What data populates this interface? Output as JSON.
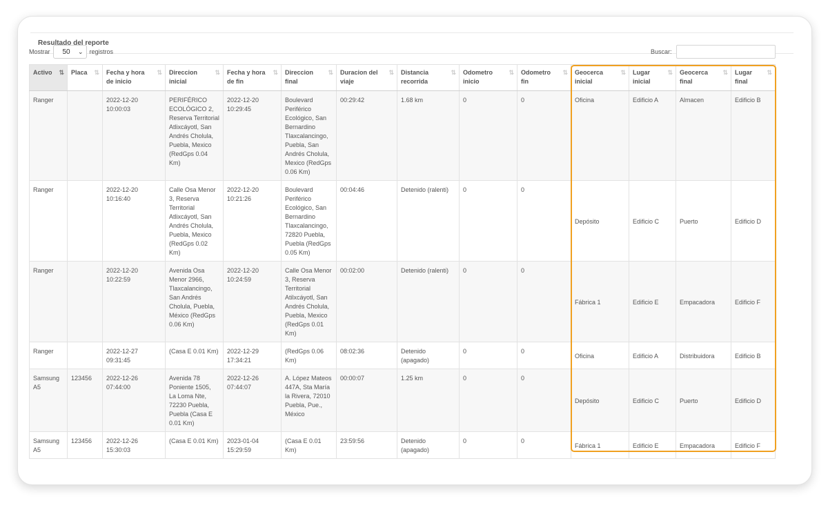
{
  "panel": {
    "title": "Resultado del reporte"
  },
  "length": {
    "prefix": "Mostrar",
    "value": "50",
    "suffix": "registros"
  },
  "search": {
    "label": "Buscar:",
    "value": ""
  },
  "table": {
    "columns": [
      "Activo",
      "Placa",
      "Fecha y hora de inicio",
      "Direccion inicial",
      "Fecha y hora de fin",
      "Direccion final",
      "Duracion del viaje",
      "Distancia recorrida",
      "Odometro inicio",
      "Odometro fin",
      "Geocerca inicial",
      "Lugar inicial",
      "Geocerca final",
      "Lugar final"
    ],
    "rows": [
      [
        "Ranger",
        "",
        "2022-12-20 10:00:03",
        "PERIFÉRICO ECOLÓGICO 2, Reserva Territorial Atlixcáyotl, San Andrés Cholula, Puebla, Mexico (RedGps 0.04 Km)",
        "2022-12-20 10:29:45",
        "Boulevard Periférico Ecológico, San Bernardino Tlaxcalancingo, Puebla, San Andrés Cholula, Mexico (RedGps 0.06 Km)",
        "00:29:42",
        "1.68 km",
        "0",
        "0",
        "Oficina",
        "Edificio A",
        "Almacen",
        "Edificio B"
      ],
      [
        "Ranger",
        "",
        "2022-12-20 10:16:40",
        "Calle Osa Menor 3, Reserva Territorial Atlixcáyotl, San Andrés Cholula, Puebla, Mexico (RedGps 0.02 Km)",
        "2022-12-20 10:21:26",
        "Boulevard Periférico Ecológico, San Bernardino Tlaxcalancingo, 72820 Puebla, Puebla (RedGps 0.05 Km)",
        "00:04:46",
        "Detenido (ralenti)",
        "0",
        "0",
        "Depósito",
        "Edificio C",
        "Puerto",
        "Edificio D"
      ],
      [
        "Ranger",
        "",
        "2022-12-20 10:22:59",
        "Avenida Osa Menor 2966, Tlaxcalancingo, San Andrés Cholula, Puebla, México (RedGps 0.06 Km)",
        "2022-12-20 10:24:59",
        "Calle Osa Menor 3, Reserva Territorial Atilxcáyotl, San Andrés Cholula, Puebla, Mexico (RedGps 0.01 Km)",
        "00:02:00",
        "Detenido (ralenti)",
        "0",
        "0",
        "Fábrica 1",
        "Edificio E",
        "Empacadora",
        "Edificio F"
      ],
      [
        "Ranger",
        "",
        "2022-12-27 09:31:45",
        "(Casa E 0.01 Km)",
        "2022-12-29 17:34:21",
        "(RedGps 0.06 Km)",
        "08:02:36",
        "Detenido (apagado)",
        "0",
        "0",
        "Oficina",
        "Edificio A",
        "Distribuidora",
        "Edificio B"
      ],
      [
        "Samsung A5",
        "123456",
        "2022-12-26 07:44:00",
        "Avenida 78 Poniente 1505, La Loma Nte, 72230 Puebla, Puebla (Casa E 0.01 Km)",
        "2022-12-26 07:44:07",
        "A. López Mateos 447A, Sta María la Rivera, 72010 Puebla, Pue., México",
        "00:00:07",
        "1.25 km",
        "0",
        "0",
        "Depósito",
        "Edificio C",
        "Puerto",
        "Edificio D"
      ],
      [
        "Samsung A5",
        "123456",
        "2022-12-26 15:30:03",
        "(Casa E 0.01 Km)",
        "2023-01-04 15:29:59",
        "(Casa E 0.01 Km)",
        "23:59:56",
        "Detenido (apagado)",
        "0",
        "0",
        "Fábrica 1",
        "Edificio E",
        "Empacadora",
        "Edificio F"
      ]
    ]
  },
  "highlight_color": "#f0a020"
}
